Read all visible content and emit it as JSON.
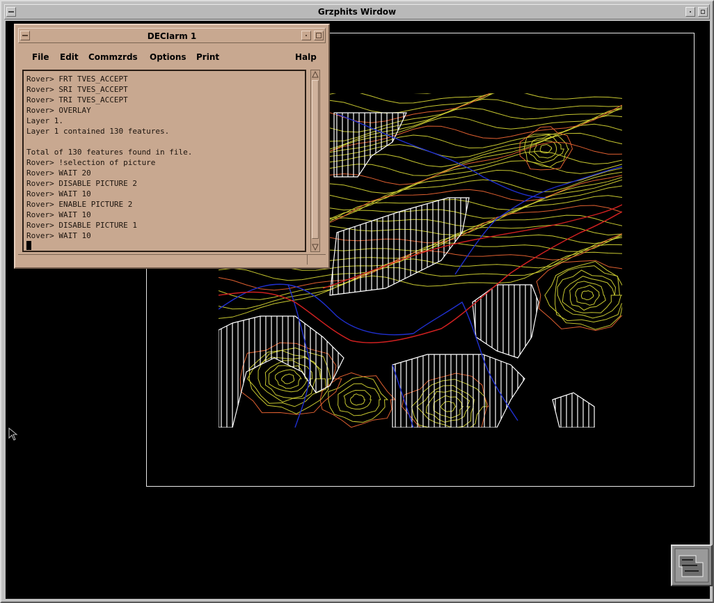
{
  "graphics_window": {
    "title": "Grzphits Wirdow"
  },
  "decterm": {
    "title": "DECIarm 1",
    "menu": [
      "File",
      "Edit",
      "Commzrds",
      "Options",
      "Print",
      "Halp"
    ],
    "terminal_lines": [
      "Rover> FRT TVES_ACCEPT",
      "Rover> SRI TVES_ACCEPT",
      "Rover> TRI TVES_ACCEPT",
      "Rover> OVERLAY",
      "Layer 1.",
      "Layer 1 contained 130 features.",
      "",
      "Total of 130 features found in file.",
      "Rover> !selection of picture",
      "Rover> WAIT 20",
      "Rover> DISABLE PICTURE 2",
      "Rover> WAIT 10",
      "Rover> ENABLE PICTURE 2",
      "Rover> WAIT 10",
      "Rover> DISABLE PICTURE 1",
      "Rover> WAIT 10"
    ]
  },
  "icons": {
    "minimize": "minimize-icon",
    "maximize": "maximize-icon",
    "window_menu": "window-menu-icon",
    "pointer": "arrow-pointer-icon",
    "corner": "iconified-app-icon"
  },
  "colors": {
    "terminal_bg": "#c8a890",
    "graphics_bg": "#000000",
    "contour_yellow": "#c8c830",
    "contour_orange": "#e06030",
    "river_blue": "#2030d0",
    "road_red": "#d02020",
    "hatch_white": "#ffffff"
  }
}
